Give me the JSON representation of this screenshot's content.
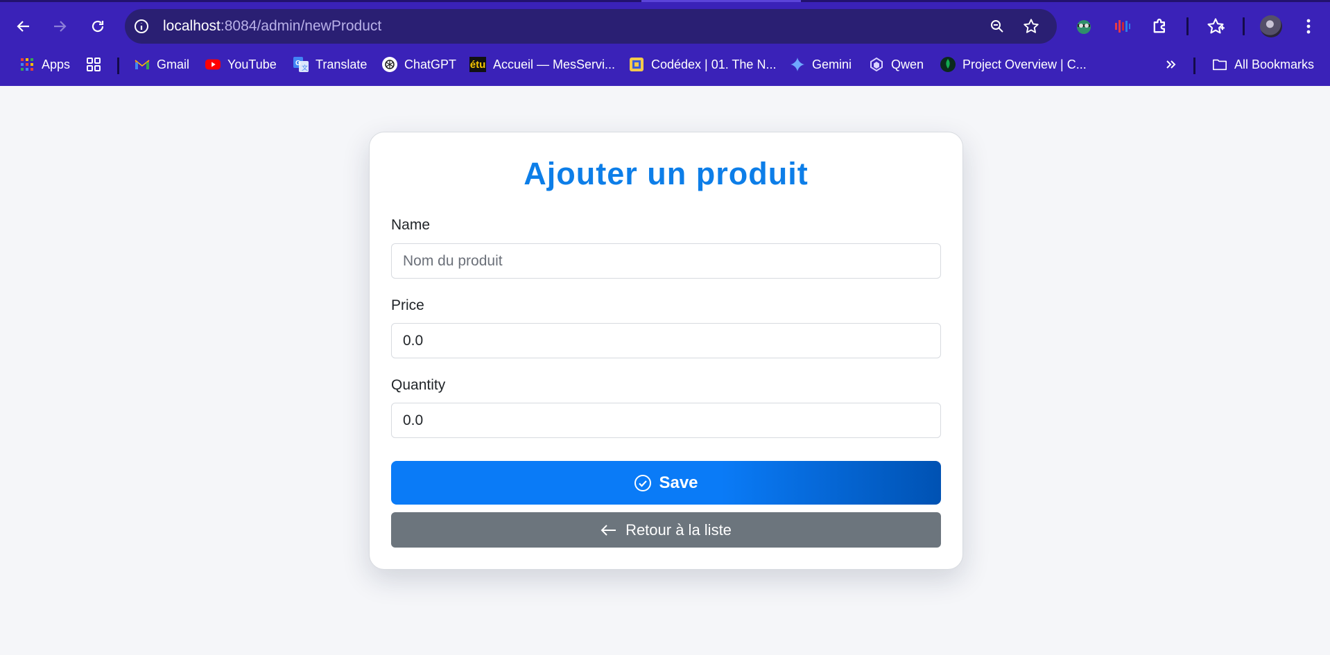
{
  "browser": {
    "url_host": "localhost",
    "url_rest": ":8084/admin/newProduct",
    "bookmarks": [
      {
        "label": "Apps",
        "icon": "apps-grid-icon"
      },
      {
        "label": "Gmail",
        "icon": "gmail-icon"
      },
      {
        "label": "YouTube",
        "icon": "youtube-icon"
      },
      {
        "label": "Translate",
        "icon": "translate-icon"
      },
      {
        "label": "ChatGPT",
        "icon": "chatgpt-icon"
      },
      {
        "label": "Accueil — MesServi...",
        "icon": "etu-icon",
        "icon_text": "étu"
      },
      {
        "label": "Codédex | 01. The N...",
        "icon": "codedex-icon"
      },
      {
        "label": "Gemini",
        "icon": "gemini-icon"
      },
      {
        "label": "Qwen",
        "icon": "qwen-icon"
      },
      {
        "label": "Project Overview | C...",
        "icon": "mongodb-leaf-icon"
      }
    ],
    "all_bookmarks_label": "All Bookmarks",
    "colors": {
      "frame": "#3a22b8",
      "omnibox": "#2a1f73"
    }
  },
  "form": {
    "title": "Ajouter un produit",
    "name_label": "Name",
    "name_placeholder": "Nom du produit",
    "name_value": "",
    "price_label": "Price",
    "price_value": "0.0",
    "quantity_label": "Quantity",
    "quantity_value": "0.0",
    "save_label": "Save",
    "back_label": "Retour à la liste",
    "colors": {
      "title": "#0d7ee8",
      "save": "#0a7bf7",
      "back": "#6c757d"
    }
  }
}
